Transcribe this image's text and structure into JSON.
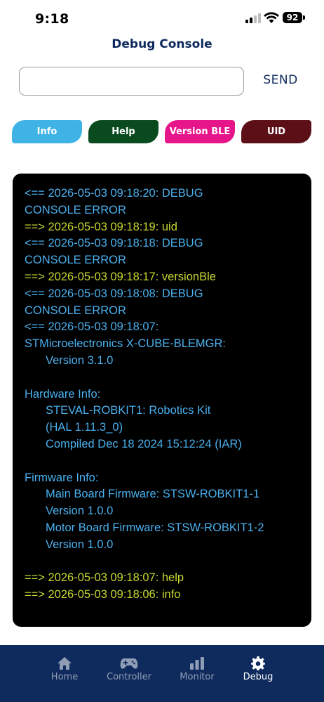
{
  "status_bar": {
    "time": "9:18",
    "battery": "92"
  },
  "header": {
    "title": "Debug Console"
  },
  "command": {
    "input_value": "",
    "placeholder": "",
    "send_label": "SEND"
  },
  "quick_buttons": [
    {
      "label": "Info",
      "color": "#3fb3e6"
    },
    {
      "label": "Help",
      "color": "#0a4a1f"
    },
    {
      "label": "Version BLE",
      "color": "#e6158a"
    },
    {
      "label": "UID",
      "color": "#5c0f16"
    }
  ],
  "console": {
    "colors": {
      "incoming": "#4ab0ee",
      "outgoing": "#c6d830"
    },
    "lines": [
      {
        "text": "<== 2026-05-03 09:18:20: DEBUG",
        "dir": "in"
      },
      {
        "text": "CONSOLE ERROR",
        "dir": "in"
      },
      {
        "text": "==> 2026-05-03 09:18:19: uid",
        "dir": "out"
      },
      {
        "text": "<== 2026-05-03 09:18:18: DEBUG",
        "dir": "in"
      },
      {
        "text": "CONSOLE ERROR",
        "dir": "in"
      },
      {
        "text": "==> 2026-05-03 09:18:17: versionBle",
        "dir": "out"
      },
      {
        "text": "<== 2026-05-03 09:18:08: DEBUG",
        "dir": "in"
      },
      {
        "text": "CONSOLE ERROR",
        "dir": "in"
      },
      {
        "text": "<== 2026-05-03 09:18:07:",
        "dir": "in"
      },
      {
        "text": "STMicroelectronics X-CUBE-BLEMGR:",
        "dir": "in"
      },
      {
        "text": "Version 3.1.0",
        "dir": "in",
        "indent": true
      },
      {
        "text": "",
        "dir": "in"
      },
      {
        "text": "Hardware Info:",
        "dir": "in"
      },
      {
        "text": "STEVAL-ROBKIT1: Robotics Kit",
        "dir": "in",
        "indent": true
      },
      {
        "text": "(HAL 1.11.3_0)",
        "dir": "in",
        "indent": true
      },
      {
        "text": "Compiled Dec 18 2024 15:12:24 (IAR)",
        "dir": "in",
        "indent": true
      },
      {
        "text": "",
        "dir": "in"
      },
      {
        "text": "Firmware Info:",
        "dir": "in"
      },
      {
        "text": "Main Board Firmware: STSW-ROBKIT1-1",
        "dir": "in",
        "indent": true
      },
      {
        "text": "Version 1.0.0",
        "dir": "in",
        "indent": true
      },
      {
        "text": "Motor Board Firmware: STSW-ROBKIT1-2",
        "dir": "in",
        "indent": true
      },
      {
        "text": "Version 1.0.0",
        "dir": "in",
        "indent": true
      },
      {
        "text": "",
        "dir": "in"
      },
      {
        "text": "==> 2026-05-03 09:18:07: help",
        "dir": "out"
      },
      {
        "text": "==> 2026-05-03 09:18:06: info",
        "dir": "out"
      }
    ]
  },
  "tab_bar": {
    "items": [
      {
        "label": "Home",
        "icon": "home-icon",
        "active": false
      },
      {
        "label": "Controller",
        "icon": "gamepad-icon",
        "active": false
      },
      {
        "label": "Monitor",
        "icon": "bar-chart-icon",
        "active": false
      },
      {
        "label": "Debug",
        "icon": "gear-icon",
        "active": true
      }
    ],
    "background": "#0f2a5c"
  }
}
